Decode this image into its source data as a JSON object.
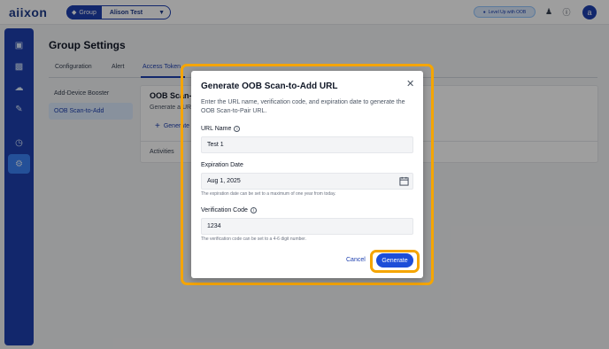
{
  "app": {
    "logo": "aiixon",
    "group_tag": "Group",
    "group_value": "Alison Test",
    "level_label": "Level Up with OOB",
    "avatar_initial": "a"
  },
  "sidebar": {
    "items": [
      {
        "icon": "dashboard-icon"
      },
      {
        "icon": "chart-icon"
      },
      {
        "icon": "cloud-icon"
      },
      {
        "icon": "puzzle-icon"
      },
      {
        "icon": "clock-icon"
      },
      {
        "icon": "gear-icon",
        "active": true
      }
    ]
  },
  "page": {
    "title": "Group Settings",
    "tabs": [
      {
        "label": "Configuration"
      },
      {
        "label": "Alert"
      },
      {
        "label": "Access Token",
        "active": true
      }
    ],
    "subnav": [
      {
        "label": "Add-Device Booster"
      },
      {
        "label": "OOB Scan-to-Add",
        "active": true
      }
    ],
    "panel": {
      "title": "OOB Scan-to-Add",
      "desc": "Generate a URL",
      "add_label": "Generate",
      "activities_label": "Activities"
    }
  },
  "modal": {
    "title": "Generate OOB Scan-to-Add URL",
    "description": "Enter the URL name, verification code, and expiration date to generate the OOB Scan-to-Pair URL.",
    "url_name_label": "URL Name",
    "url_name_value": "Test 1",
    "expiration_label": "Expiration Date",
    "expiration_value": "Aug 1, 2025",
    "expiration_help": "The expiration date can be set to a maximum of one year from today.",
    "verification_label": "Verification Code",
    "verification_value": "1234",
    "verification_help": "The verification code can be set to a 4-6 digit number.",
    "cancel_label": "Cancel",
    "generate_label": "Generate"
  },
  "colors": {
    "brand": "#1e40af",
    "highlight": "#f5a500",
    "primary_button": "#1d4ed8"
  }
}
